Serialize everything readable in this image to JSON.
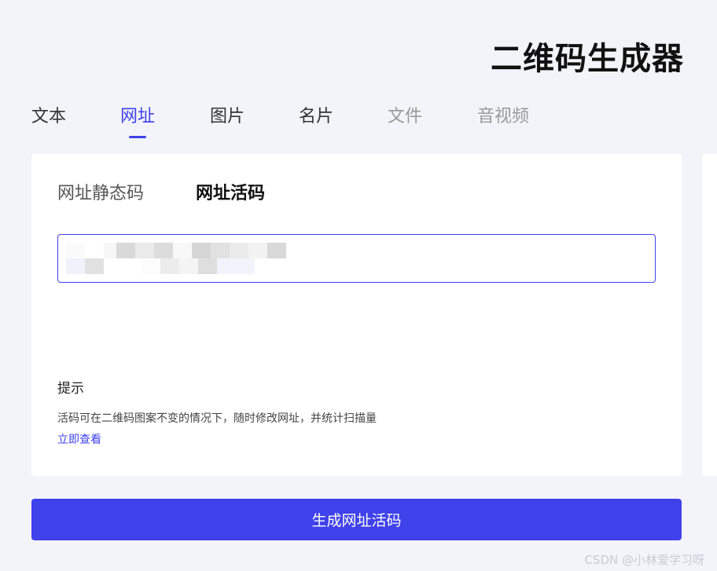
{
  "header": {
    "title": "二维码生成器"
  },
  "tabs": [
    {
      "label": "文本",
      "state": "normal"
    },
    {
      "label": "网址",
      "state": "active"
    },
    {
      "label": "图片",
      "state": "normal"
    },
    {
      "label": "名片",
      "state": "normal"
    },
    {
      "label": "文件",
      "state": "disabled"
    },
    {
      "label": "音视频",
      "state": "disabled"
    }
  ],
  "card": {
    "subtabs": {
      "static_label": "网址静态码",
      "dynamic_label": "网址活码"
    },
    "url_input": {
      "value": ""
    },
    "hint": {
      "title": "提示",
      "text": "活码可在二维码图案不变的情况下，随时修改网址，并统计扫描量",
      "link": "立即查看"
    }
  },
  "generate_button": {
    "label": "生成网址活码"
  },
  "watermark": {
    "text": "CSDN @小林爱学习呀"
  },
  "colors": {
    "accent": "#3f41ea",
    "background": "#f3f4f9",
    "card": "#ffffff"
  }
}
